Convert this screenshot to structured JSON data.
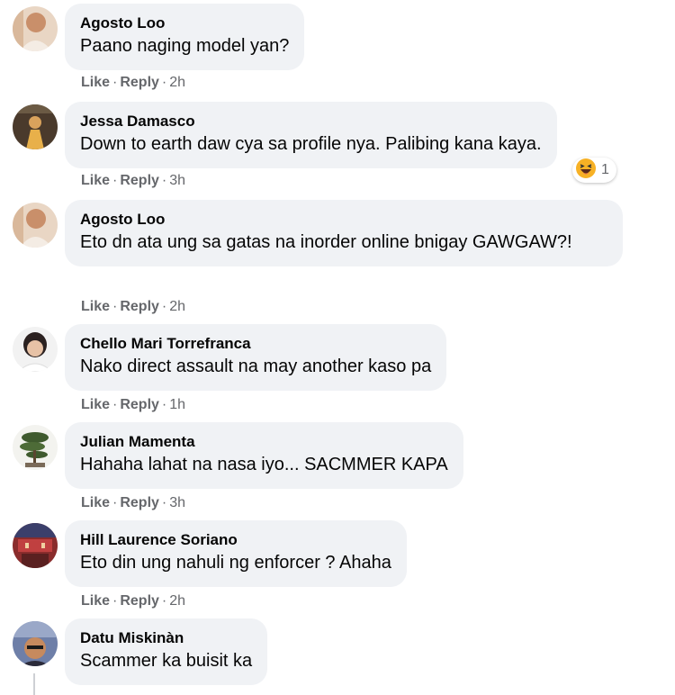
{
  "comments": [
    {
      "author": "Agosto Loo",
      "text": "Paano naging model yan?",
      "like": "Like",
      "reply": "Reply",
      "time": "2h"
    },
    {
      "author": "Jessa Damasco",
      "text": "Down to earth daw cya sa profile nya. Palibing kana kaya.",
      "like": "Like",
      "reply": "Reply",
      "time": "3h",
      "reaction": {
        "icon": "haha-emoji-icon",
        "count": "1"
      }
    },
    {
      "author": "Agosto Loo",
      "text": "Eto dn ata ung sa gatas na inorder online bnigay GAWGAW?!",
      "like": "Like",
      "reply": "Reply",
      "time": "2h"
    },
    {
      "author": "Chello Mari Torrefranca",
      "text": "Nako direct assault na may another kaso pa",
      "like": "Like",
      "reply": "Reply",
      "time": "1h"
    },
    {
      "author": "Julian Mamenta",
      "text": "Hahaha lahat na nasa iyo... SACMMER KAPA",
      "like": "Like",
      "reply": "Reply",
      "time": "3h"
    },
    {
      "author": "Hill Laurence Soriano",
      "text": "Eto din ung nahuli ng enforcer ? Ahaha",
      "like": "Like",
      "reply": "Reply",
      "time": "2h"
    },
    {
      "author": "Datu Miskinàn",
      "text": "Scammer ka buisit ka"
    }
  ],
  "separator": "·"
}
